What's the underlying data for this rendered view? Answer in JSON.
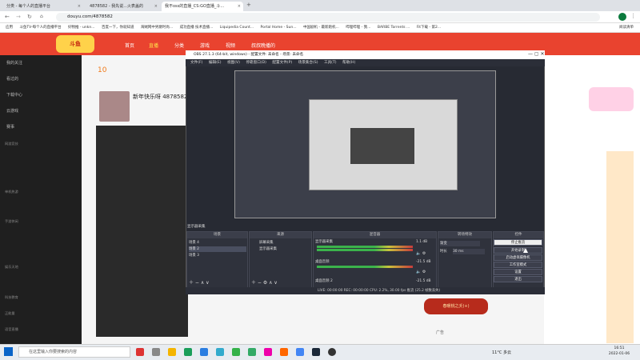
{
  "browser": {
    "tabs": [
      {
        "label": "分类 - 每个人的直播平台",
        "active": false
      },
      {
        "label": "4878582 - 我先说...火表盖的",
        "active": false
      },
      {
        "label": "我不oss的直播_CS:GO直播_斗...",
        "active": true
      }
    ],
    "url": "douyu.com/4878582",
    "bookmarks": [
      "应用",
      "斗鱼TV-每个人的直播平台",
      "好物推 - unkn...",
      "百度一下，你就知道",
      "海贼网中男巅时尚...",
      "成功直播 技术直播...",
      "Liquipedia Count...",
      "Portal Home - Sun...",
      "中国剧机 - 最新跑机...",
      "哔哩哔哩 - 我...",
      "BARBE Torrents ...",
      "Fit下载 - 第2...",
      "阅读清单"
    ]
  },
  "douyu": {
    "logo": "斗鱼",
    "nav": [
      "首页",
      "直播",
      "分类",
      "游戏",
      "视频",
      "叔叔晚播的"
    ],
    "sidebar_items": [
      "我的关注",
      "看过的",
      "下载中心",
      "云游戏",
      "赛事"
    ],
    "sidebar_groups": [
      "网游竞技",
      "单机热游",
      "手游休闲",
      "娱乐天地",
      "科技教育",
      "正能量",
      "语音直播"
    ],
    "streamer_title": "新年快乐呀 4878582",
    "follow_count": "10",
    "ad_text": "春暖桃之夭(+)",
    "ad_label": "广告"
  },
  "obs": {
    "title": "OBS 27.1.3 (64-bit, windows) - 配置文件: 未命名 - 场景: 未命名",
    "menu": [
      "文件(F)",
      "编辑(E)",
      "视图(V)",
      "停靠窗口(D)",
      "配置文件(P)",
      "场景集合(S)",
      "工具(T)",
      "帮助(H)"
    ],
    "source_preview_label": "显示器采集",
    "docks": {
      "scenes": {
        "header": "场景",
        "items": [
          "场景 4",
          "场景 2",
          "场景 3"
        ]
      },
      "sources": {
        "header": "来源",
        "items": [
          "屏幕采集",
          "显示器采集"
        ]
      },
      "mixer": {
        "header": "混音器",
        "tracks": [
          {
            "name": "显示器采集",
            "level": "1.1 dB"
          },
          {
            "name": "桌面音频",
            "level": "-21.5 dB"
          },
          {
            "name": "桌面音频 2",
            "level": "-21.5 dB"
          }
        ]
      },
      "transitions": {
        "header": "转场特效",
        "type": "渐变",
        "duration_label": "时长",
        "duration_value": "30 ms"
      },
      "controls": {
        "header": "控件",
        "buttons": [
          "停止推流",
          "开始录制",
          "启动虚拟摄像机",
          "工作室模式",
          "设置",
          "退出"
        ]
      }
    },
    "status": "LIVE: 00:00:00  REC: 00:00:00  CPU: 2.2%, 30.00 fps  推流 (25.2 帧数丢失)"
  },
  "taskbar": {
    "search_placeholder": "在这里输入你要搜索的内容",
    "weather": "11°C 多云",
    "time": "16:51",
    "date": "2022-01-06"
  },
  "colors": {
    "douyu_accent": "#e9432f",
    "obs_bg": "#272a33"
  }
}
